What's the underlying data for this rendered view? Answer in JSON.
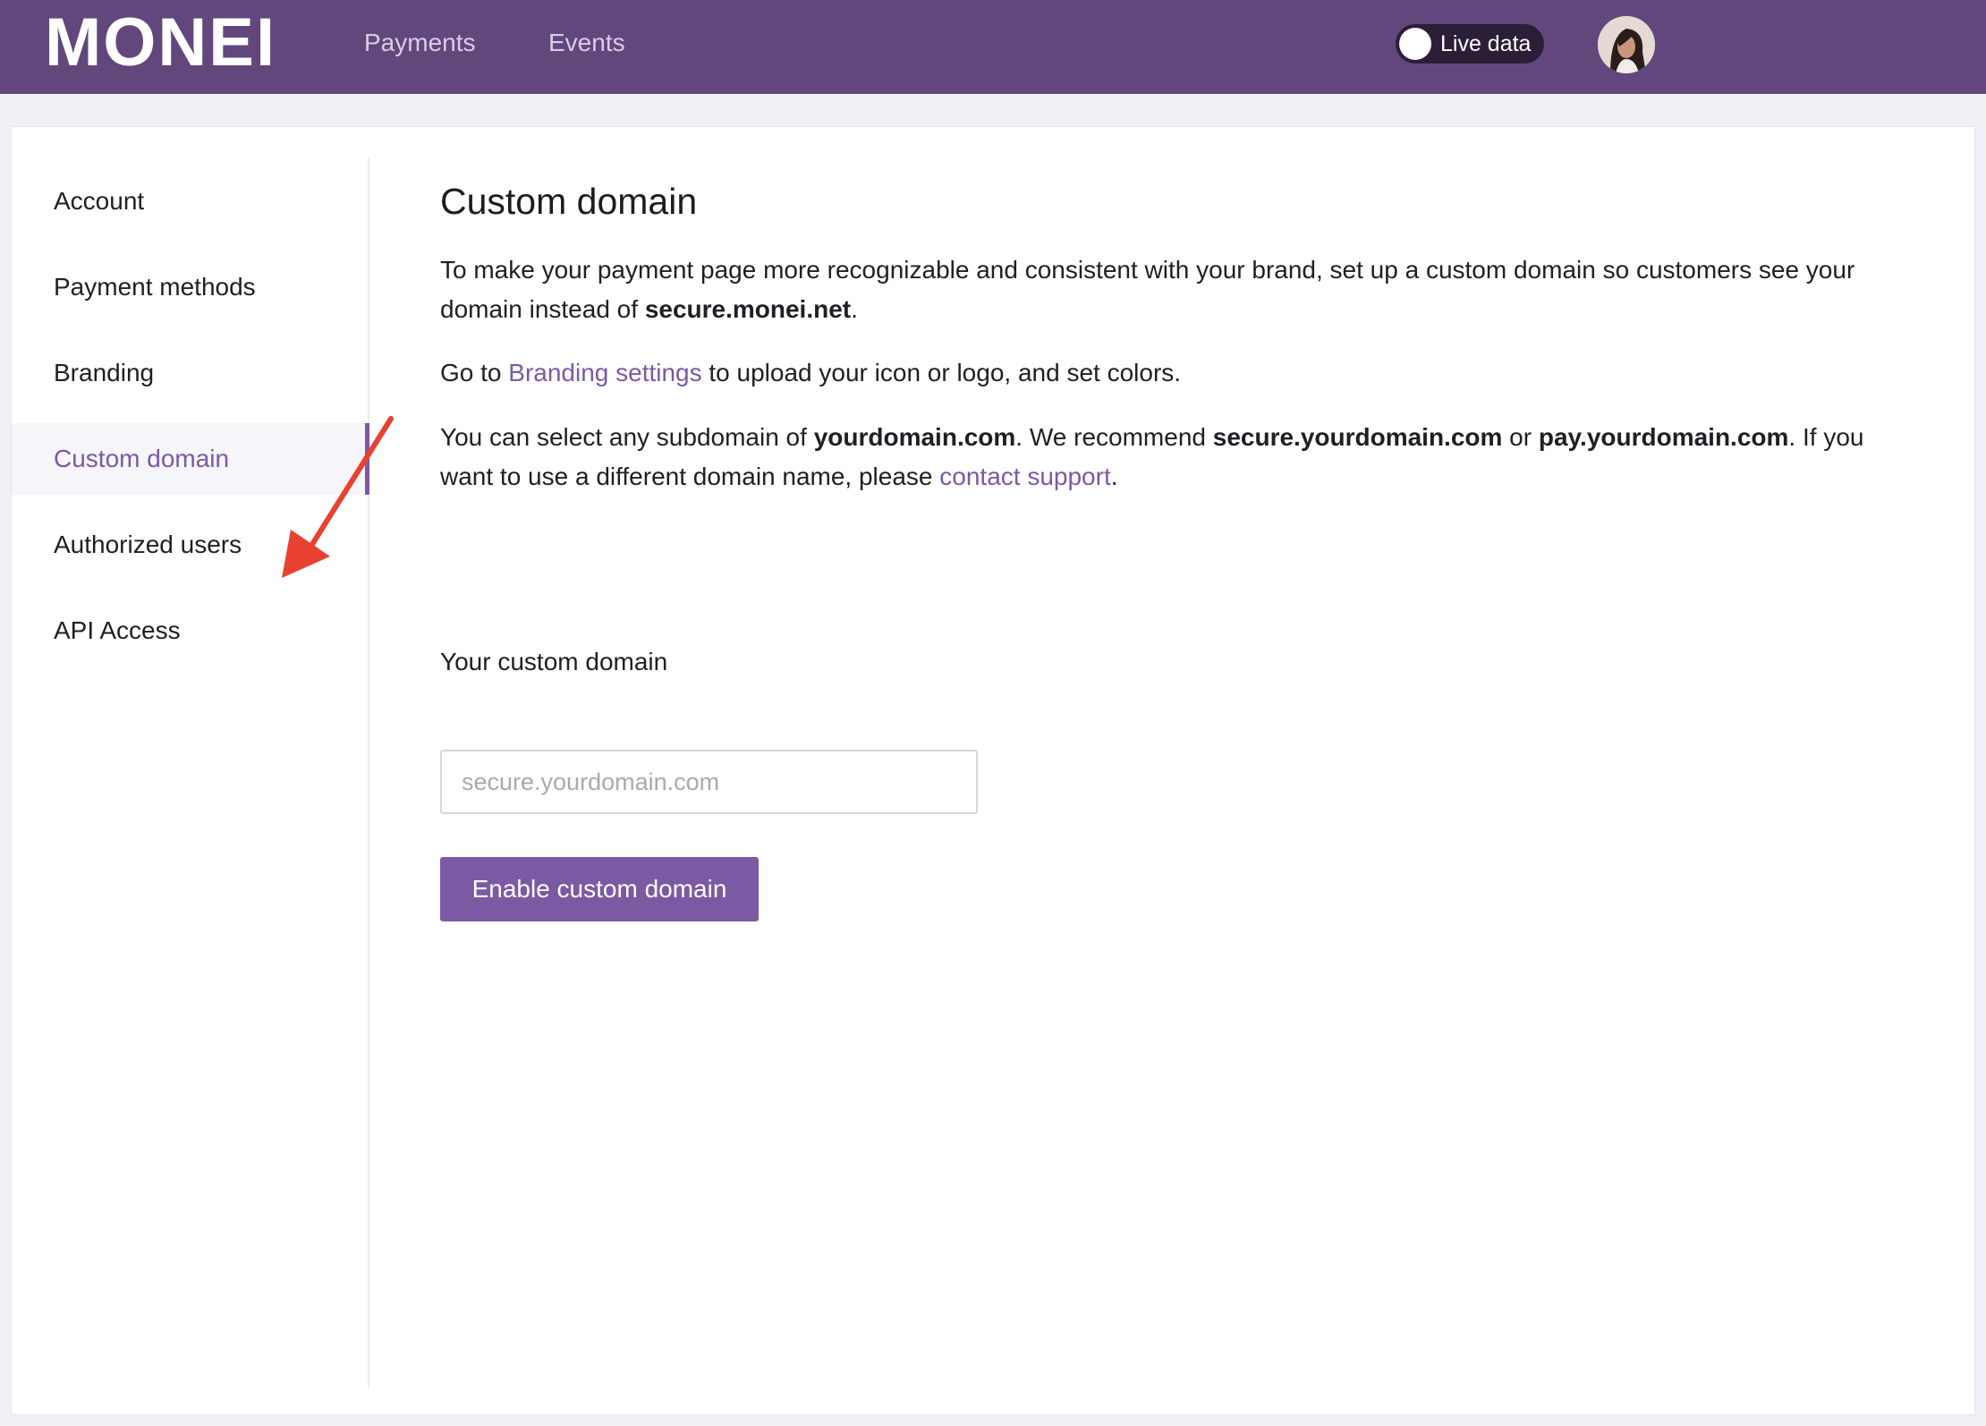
{
  "header": {
    "logo": "MONEI",
    "nav": [
      {
        "label": "Payments"
      },
      {
        "label": "Events"
      }
    ],
    "live_toggle": {
      "label": "Live data",
      "state": "off"
    },
    "avatar_icon": "user-avatar"
  },
  "sidebar": {
    "items": [
      {
        "label": "Account"
      },
      {
        "label": "Payment methods"
      },
      {
        "label": "Branding"
      },
      {
        "label": "Custom domain",
        "active": true
      },
      {
        "label": "Authorized users"
      },
      {
        "label": "API Access"
      }
    ]
  },
  "main": {
    "title": "Custom domain",
    "p1": {
      "text": "To make your payment page more recognizable and consistent with your brand, set up a custom domain so customers see your domain instead of ",
      "bold": "secure.monei.net",
      "end": "."
    },
    "p2": {
      "start": "Go to ",
      "link": "Branding settings",
      "end": " to upload your icon or logo, and set colors."
    },
    "p3": {
      "t1": "You can select any subdomain of ",
      "b1": "yourdomain.com",
      "t2": ". We recommend ",
      "b2": "secure.yourdomain.com",
      "t3": " or ",
      "b3": "pay.yourdomain.com",
      "t4": ". If you want to use a different domain name, please ",
      "link": "contact support",
      "t5": "."
    },
    "field_label": "Your custom domain",
    "field_value": "",
    "field_placeholder": "secure.yourdomain.com",
    "button_label": "Enable custom domain"
  },
  "annotation": {
    "arrow_color": "#e8412f",
    "arrow_icon": "red-arrow-icon"
  },
  "colors": {
    "header_bg": "#62477d",
    "accent": "#7b59a3",
    "toggle_bg": "#2b1f38"
  }
}
